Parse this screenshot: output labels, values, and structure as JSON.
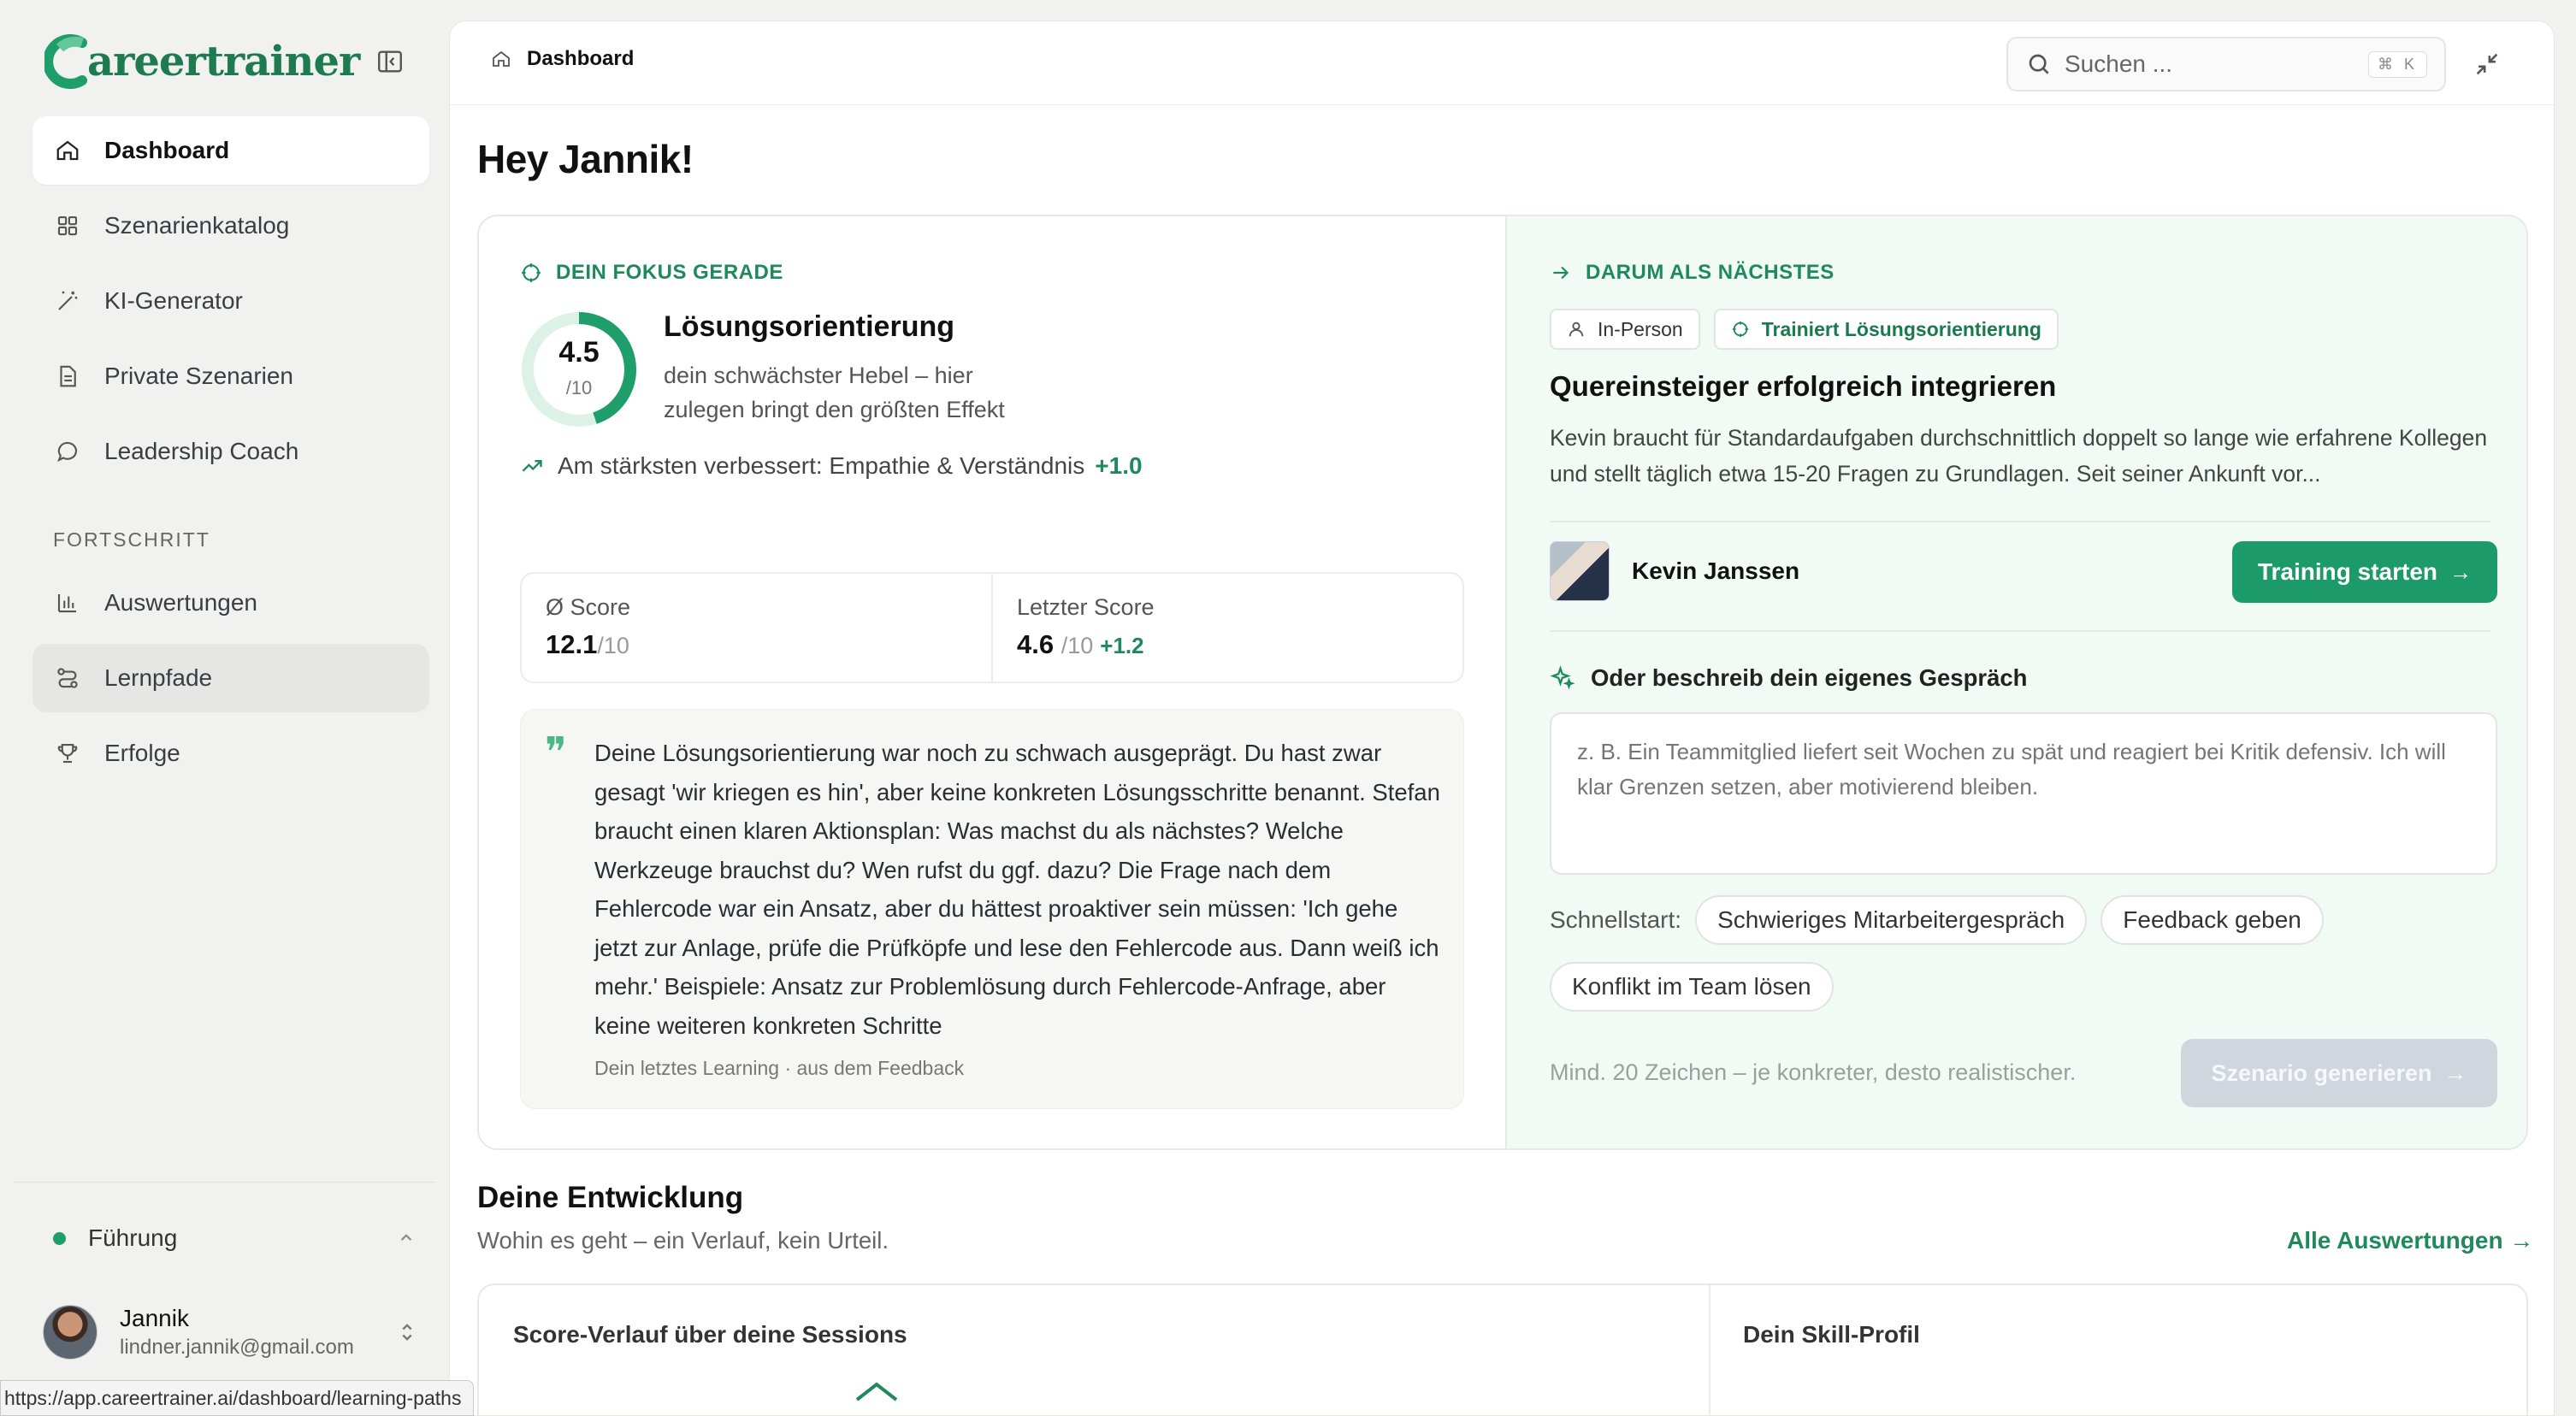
{
  "brand": {
    "logo_text": "areertrainer",
    "color": "#1e7a4f"
  },
  "sidebar": {
    "items": [
      {
        "label": "Dashboard",
        "icon": "home-icon",
        "active": true
      },
      {
        "label": "Szenarienkatalog",
        "icon": "grid-icon"
      },
      {
        "label": "KI-Generator",
        "icon": "magic-wand-icon"
      },
      {
        "label": "Private Szenarien",
        "icon": "document-icon"
      },
      {
        "label": "Leadership Coach",
        "icon": "chat-bubble-icon"
      }
    ],
    "section_label": "FORTSCHRITT",
    "section_items": [
      {
        "label": "Auswertungen",
        "icon": "bar-chart-icon"
      },
      {
        "label": "Lernpfade",
        "icon": "route-icon",
        "hovered": true
      },
      {
        "label": "Erfolge",
        "icon": "trophy-icon"
      }
    ],
    "workspace": "Führung",
    "user": {
      "name": "Jannik",
      "email": "lindner.jannik@gmail.com"
    }
  },
  "topbar": {
    "breadcrumb": "Dashboard",
    "search_placeholder": "Suchen ...",
    "search_shortcut": "⌘ K"
  },
  "greeting": "Hey Jannik!",
  "focus": {
    "eyebrow": "DEIN FOKUS GERADE",
    "score": "4.5",
    "score_den": "/10",
    "score_fraction": 0.45,
    "title": "Lösungsorientierung",
    "desc": "dein schwächster Hebel – hier zulegen bringt den größten Effekt",
    "improved_label": "Am stärksten verbessert: Empathie & Verständnis",
    "improved_delta": "+1.0",
    "avg_label": "Ø Score",
    "avg_value": "12.1",
    "avg_den": "/10",
    "last_label": "Letzter Score",
    "last_value": "4.6",
    "last_den": "/10",
    "last_delta": "+1.2",
    "quote": "Deine Lösungsorientierung war noch zu schwach ausgeprägt. Du hast zwar gesagt 'wir kriegen es hin', aber keine konkreten Lösungsschritte benannt. Stefan braucht einen klaren Aktionsplan: Was machst du als nächstes? Welche Werkzeuge brauchst du? Wen rufst du ggf. dazu? Die Frage nach dem Fehlercode war ein Ansatz, aber du hättest proaktiver sein müssen: 'Ich gehe jetzt zur Anlage, prüfe die Prüfköpfe und lese den Fehlercode aus. Dann weiß ich mehr.' Beispiele: Ansatz zur Problemlösung durch Fehlercode-Anfrage, aber keine weiteren konkreten Schritte",
    "quote_source": "Dein letztes Learning · aus dem Feedback"
  },
  "next": {
    "eyebrow": "DARUM ALS NÄCHSTES",
    "tag_mode": "In-Person",
    "tag_skill": "Trainiert Lösungsorientierung",
    "title": "Quereinsteiger erfolgreich integrieren",
    "desc": "Kevin braucht für Standardaufgaben durchschnittlich doppelt so lange wie erfahrene Kollegen und stellt täglich etwa 15-20 Fragen zu Grundlagen. Seit seiner Ankunft vor...",
    "person": "Kevin Janssen",
    "start_button": "Training starten",
    "own_heading": "Oder beschreib dein eigenes Gespräch",
    "own_placeholder": "z. B. Ein Teammitglied liefert seit Wochen zu spät und reagiert bei Kritik defensiv. Ich will klar Grenzen setzen, aber motivierend bleiben.",
    "quick_label": "Schnellstart:",
    "quick_chips": [
      "Schwieriges Mitarbeitergespräch",
      "Feedback geben",
      "Konflikt im Team lösen"
    ],
    "hint": "Mind. 20 Zeichen – je konkreter, desto realistischer.",
    "generate_button": "Szenario generieren"
  },
  "development": {
    "title": "Deine Entwicklung",
    "subtitle": "Wohin es geht – ein Verlauf, kein Urteil.",
    "link": "Alle Auswertungen",
    "panel_1": "Score-Verlauf über deine Sessions",
    "panel_2": "Dein Skill-Profil"
  },
  "status_url": "https://app.careertrainer.ai/dashboard/learning-paths",
  "colors": {
    "accent": "#1c9a6a",
    "accent_text": "#1e8a5c",
    "highlight_bg": "#f1faf5"
  }
}
